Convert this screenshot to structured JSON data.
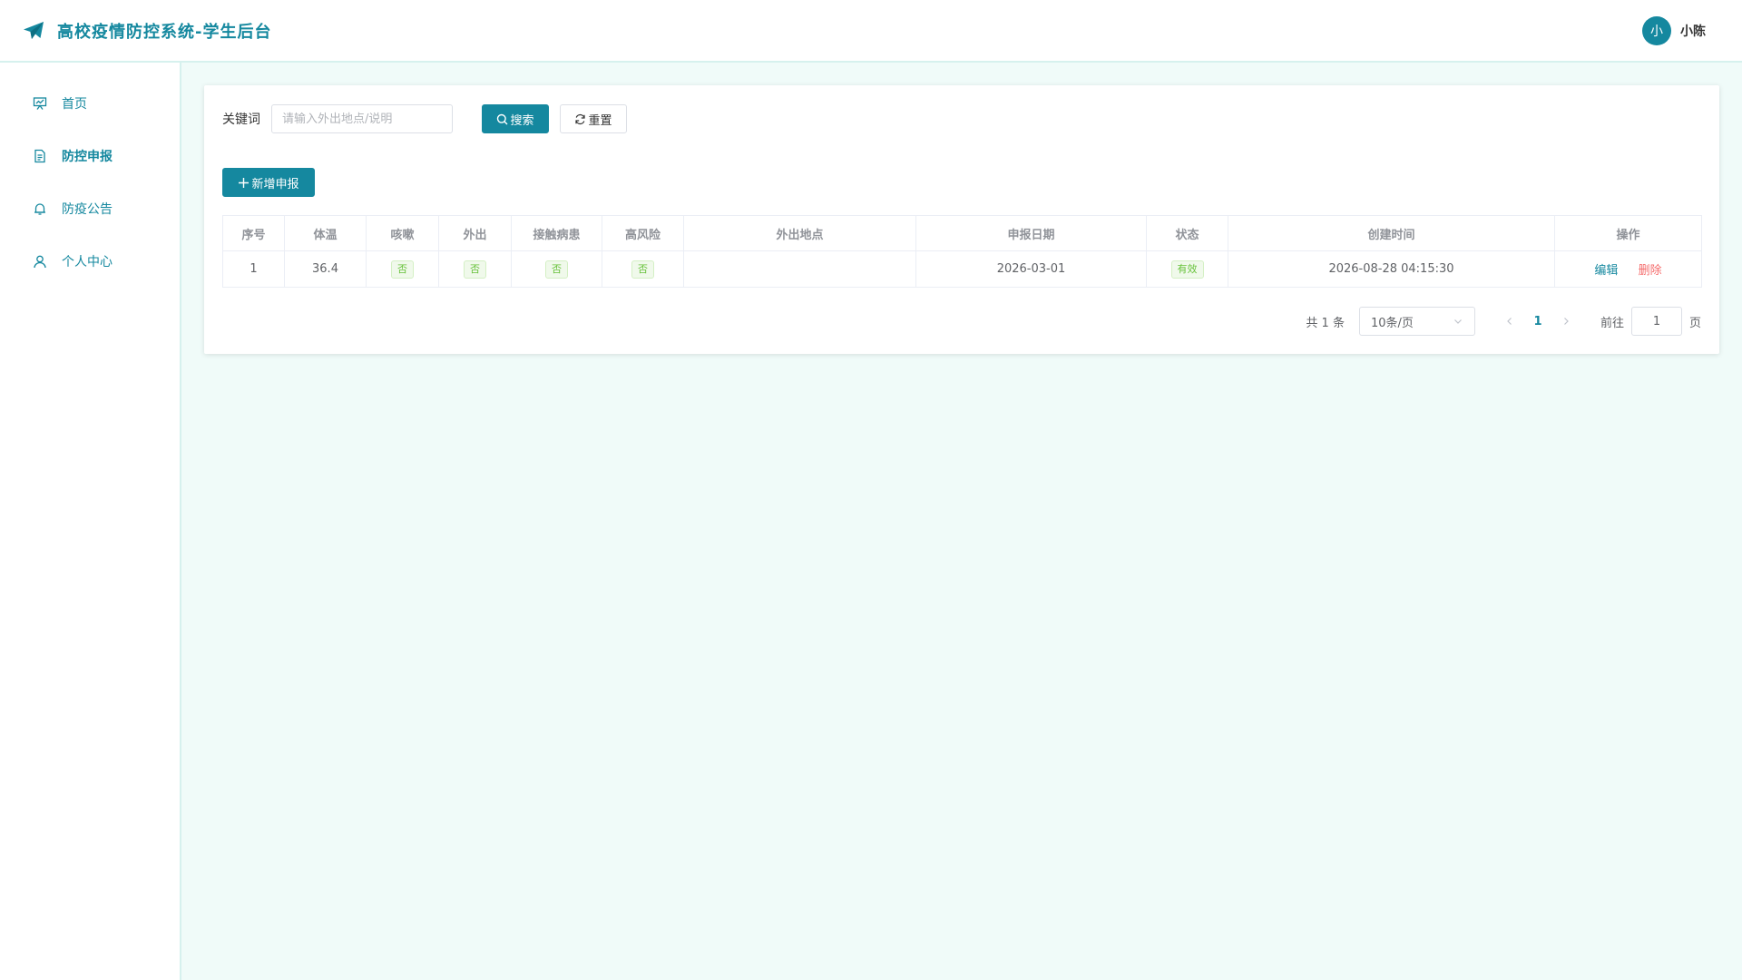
{
  "header": {
    "title": "高校疫情防控系统-学生后台",
    "brand_icon": "paper-plane-icon",
    "user": {
      "avatar_text": "小",
      "name": "小陈"
    }
  },
  "sidebar": {
    "items": [
      {
        "label": "首页",
        "icon": "presentation-icon"
      },
      {
        "label": "防控申报",
        "icon": "document-icon",
        "active": true
      },
      {
        "label": "防疫公告",
        "icon": "bell-icon"
      },
      {
        "label": "个人中心",
        "icon": "user-icon"
      }
    ]
  },
  "search": {
    "label": "关键词",
    "placeholder": "请输入外出地点/说明",
    "value": "",
    "search_button": "搜索",
    "reset_button": "重置"
  },
  "actions": {
    "add_button": "新增申报"
  },
  "table": {
    "columns": [
      "序号",
      "体温",
      "咳嗽",
      "外出",
      "接触病患",
      "高风险",
      "外出地点",
      "申报日期",
      "状态",
      "创建时间",
      "操作"
    ],
    "rows": [
      {
        "index": "1",
        "temperature": "36.4",
        "cough": "否",
        "outing": "否",
        "contact": "否",
        "high_risk": "否",
        "location": "",
        "report_date": "2026-03-01",
        "status": "有效",
        "created_at": "2026-08-28 04:15:30",
        "edit_label": "编辑",
        "delete_label": "删除"
      }
    ]
  },
  "pagination": {
    "total_text": "共 1 条",
    "page_size": "10条/页",
    "current_page": "1",
    "goto_label": "前往",
    "goto_value": "1",
    "goto_suffix": "页"
  },
  "colors": {
    "primary": "#15889f",
    "danger": "#f56c6c",
    "success": "#67c23a",
    "background": "#f0fbf9"
  }
}
